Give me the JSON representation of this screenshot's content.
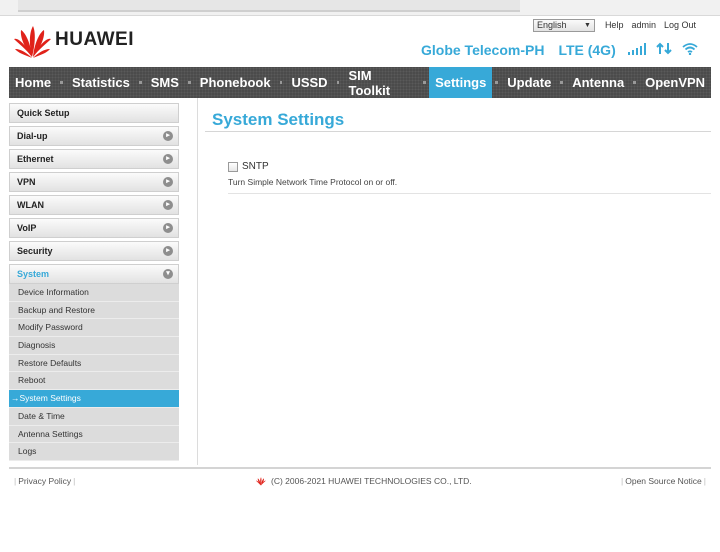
{
  "header": {
    "brand": "HUAWEI",
    "language": "English",
    "links": {
      "help": "Help",
      "user": "admin",
      "logout": "Log Out"
    },
    "status": {
      "carrier": "Globe Telecom-PH",
      "network": "LTE (4G)"
    }
  },
  "nav": {
    "items": [
      {
        "label": "Home",
        "active": false
      },
      {
        "label": "Statistics",
        "active": false
      },
      {
        "label": "SMS",
        "active": false
      },
      {
        "label": "Phonebook",
        "active": false
      },
      {
        "label": "USSD",
        "active": false
      },
      {
        "label": "SIM Toolkit",
        "active": false
      },
      {
        "label": "Settings",
        "active": true
      },
      {
        "label": "Update",
        "active": false
      },
      {
        "label": "Antenna",
        "active": false
      },
      {
        "label": "OpenVPN",
        "active": false
      }
    ]
  },
  "sidebar": {
    "sections": [
      {
        "label": "Quick Setup"
      },
      {
        "label": "Dial-up"
      },
      {
        "label": "Ethernet"
      },
      {
        "label": "VPN"
      },
      {
        "label": "WLAN"
      },
      {
        "label": "VoIP"
      },
      {
        "label": "Security"
      },
      {
        "label": "System"
      }
    ],
    "system_items": [
      {
        "label": "Device Information"
      },
      {
        "label": "Backup and Restore"
      },
      {
        "label": "Modify Password"
      },
      {
        "label": "Diagnosis"
      },
      {
        "label": "Restore Defaults"
      },
      {
        "label": "Reboot"
      },
      {
        "label": "System Settings"
      },
      {
        "label": "Date & Time"
      },
      {
        "label": "Antenna Settings"
      },
      {
        "label": "Logs"
      }
    ],
    "active_marker": "→"
  },
  "main": {
    "title": "System Settings",
    "sntp_label": "SNTP",
    "sntp_checked": false,
    "sntp_description": "Turn Simple Network Time Protocol on or off."
  },
  "footer": {
    "privacy": "Privacy Policy",
    "copyright": "(C) 2006-2021 HUAWEI TECHNOLOGIES CO., LTD.",
    "open_source": "Open Source Notice"
  },
  "colors": {
    "accent": "#37a9d8",
    "nav_bg": "#4b4b4b",
    "logo_red": "#e0221a"
  }
}
